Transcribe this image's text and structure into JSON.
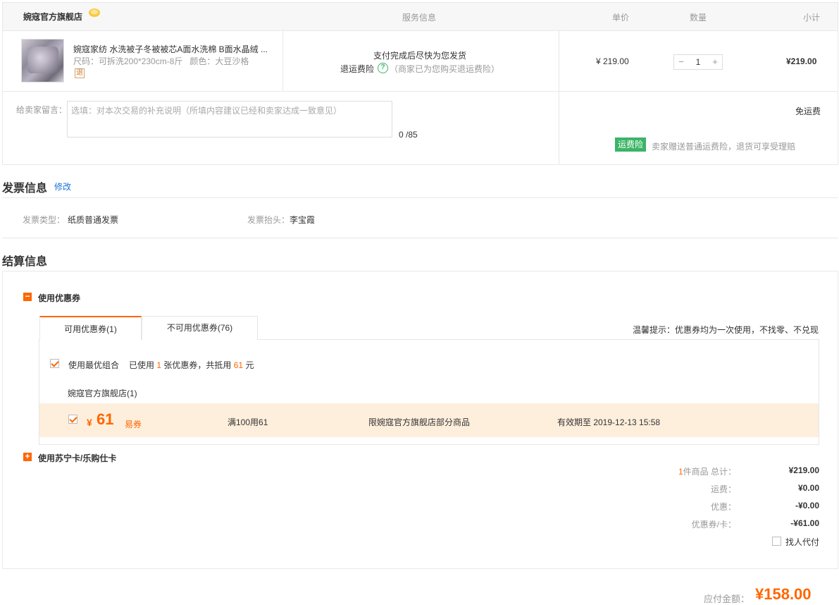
{
  "order": {
    "store_name": "婉寇官方旗舰店",
    "col_service": "服务信息",
    "col_price": "单价",
    "col_qty": "数量",
    "col_subtotal": "小计",
    "item": {
      "title": "婉寇家纺 水洗被子冬被被芯A面水洗棉 B面水晶绒 ...",
      "spec": "尺码：可拆洗200*230cm-8斤   颜色：大豆沙格",
      "return_tag": "退",
      "ship_note": "支付完成后尽快为您发货",
      "insurance_label": "退运费险",
      "insurance_note": "（商家已为您购买退运费险）",
      "price": "¥ 219.00",
      "qty": "1",
      "subtotal": "¥219.00"
    },
    "message_label": "给卖家留言：",
    "message_placeholder": "选填：对本次交易的补充说明（所填内容建议已经和卖家达成一致意见）",
    "message_count": "0 /85",
    "shipping_free": "免运费",
    "insurance_badge": "运费险",
    "insurance_desc": "卖家赠送普通运费险，退货可享受理赔"
  },
  "invoice": {
    "title": "发票信息",
    "edit": "修改",
    "type_label": "发票类型：",
    "type_value": "纸质普通发票",
    "header_label": "发票抬头：",
    "header_value": "李宝霞"
  },
  "settlement": {
    "title": "结算信息",
    "coupon_toggle": "使用优惠券",
    "tab_available": "可用优惠券(1)",
    "tab_unavailable": "不可用优惠券(76)",
    "tip": "温馨提示：优惠券均为一次使用，不找零、不兑现",
    "best_combo": "使用最优组合",
    "used_prefix": "已使用",
    "used_count": "1",
    "used_mid": "张优惠券，共抵用",
    "used_amount": "61",
    "used_unit": "元",
    "store_group": "婉寇官方旗舰店(1)",
    "coupon": {
      "currency": "¥",
      "amount": "61",
      "type": "易券",
      "rule": "满100用61",
      "scope": "限婉寇官方旗舰店部分商品",
      "expiry": "有效期至 2019-12-13 15:58"
    },
    "card_toggle": "使用苏宁卡/乐购仕卡",
    "summary": {
      "count": "1",
      "count_label": "件商品 总计：",
      "total": "¥219.00",
      "shipping_label": "运费：",
      "shipping": "¥0.00",
      "discount_label": "优惠：",
      "discount": "-¥0.00",
      "coupon_label": "优惠券/卡：",
      "coupon": "-¥61.00",
      "proxy_pay": "找人代付"
    },
    "payable_label": "应付金额：",
    "payable": "¥158.00"
  },
  "colors": {
    "accent": "#ff6600",
    "green": "#3bb466"
  }
}
